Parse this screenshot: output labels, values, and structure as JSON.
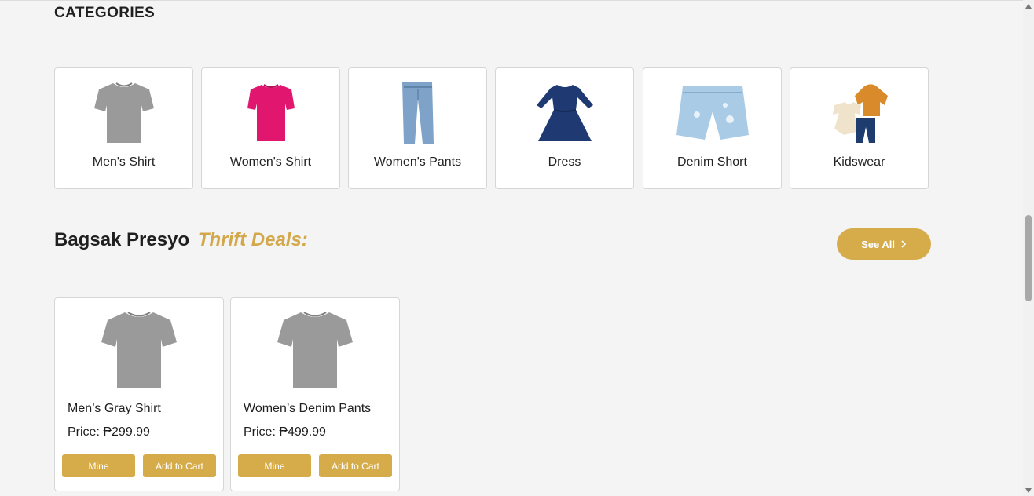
{
  "categories": {
    "title": "CATEGORIES",
    "items": [
      {
        "label": "Men's Shirt",
        "icon": "gray-tshirt-icon"
      },
      {
        "label": "Women's Shirt",
        "icon": "pink-tshirt-icon"
      },
      {
        "label": "Women's Pants",
        "icon": "jeans-icon"
      },
      {
        "label": "Dress",
        "icon": "dress-icon"
      },
      {
        "label": "Denim Short",
        "icon": "denim-short-icon"
      },
      {
        "label": "Kidswear",
        "icon": "kidswear-icon"
      }
    ]
  },
  "deals": {
    "title": "Bagsak Presyo",
    "accent": "Thrift Deals:",
    "see_all_label": "See All",
    "products": [
      {
        "name": "Men’s Gray Shirt",
        "price": "Price: ₱299.99",
        "mine_label": "Mine",
        "cart_label": "Add to Cart"
      },
      {
        "name": "Women’s Denim Pants",
        "price": "Price: ₱499.99",
        "mine_label": "Mine",
        "cart_label": "Add to Cart"
      }
    ]
  },
  "colors": {
    "accent": "#d6ac4b",
    "accent_text": "#d3a84a",
    "background": "#f4f4f4"
  }
}
